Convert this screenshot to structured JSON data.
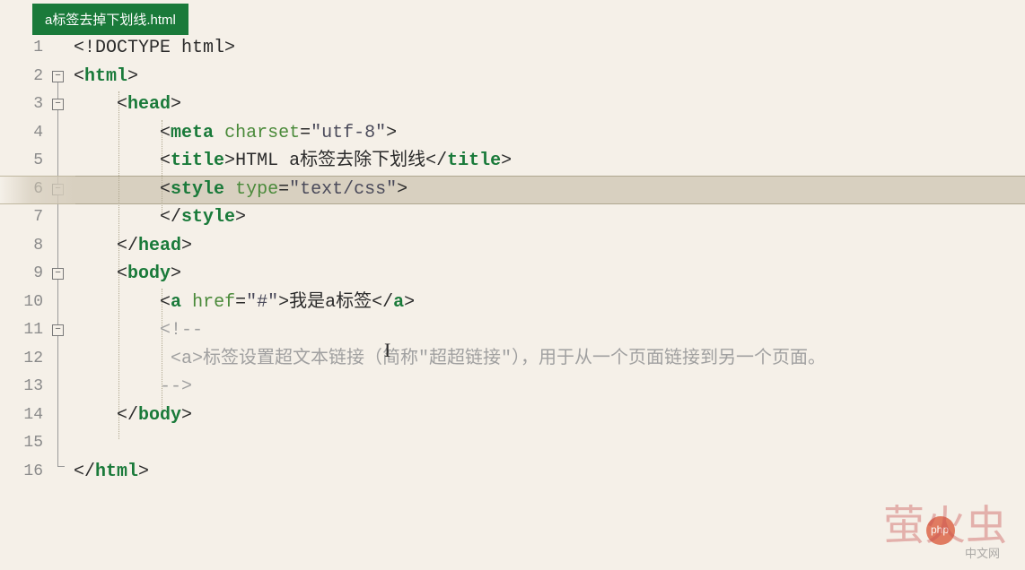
{
  "tab": {
    "filename": "a标签去掉下划线.html"
  },
  "lines": [
    "1",
    "2",
    "3",
    "4",
    "5",
    "6",
    "7",
    "8",
    "9",
    "10",
    "11",
    "12",
    "13",
    "14",
    "15",
    "16"
  ],
  "code": {
    "l1": {
      "doctype": "<!DOCTYPE html>"
    },
    "l2": {
      "open": "<",
      "tag": "html",
      "close": ">"
    },
    "l3": {
      "open": "<",
      "tag": "head",
      "close": ">"
    },
    "l4": {
      "open": "<",
      "tag": "meta",
      "sp": " ",
      "attr": "charset",
      "eq": "=",
      "val": "\"utf-8\"",
      "close": ">"
    },
    "l5": {
      "open": "<",
      "tag": "title",
      "close": ">",
      "text": "HTML a标签去除下划线",
      "open2": "</",
      "tag2": "title",
      "close2": ">"
    },
    "l6": {
      "open": "<",
      "tag": "style",
      "sp": " ",
      "attr": "type",
      "eq": "=",
      "val": "\"text/css\"",
      "close": ">"
    },
    "l7": {
      "open": "</",
      "tag": "style",
      "close": ">"
    },
    "l8": {
      "open": "</",
      "tag": "head",
      "close": ">"
    },
    "l9": {
      "open": "<",
      "tag": "body",
      "close": ">"
    },
    "l10": {
      "open": "<",
      "tag": "a",
      "sp": " ",
      "attr": "href",
      "eq": "=",
      "val": "\"#\"",
      "close": ">",
      "text": "我是a标签",
      "open2": "</",
      "tag2": "a",
      "close2": ">"
    },
    "l11": {
      "comment_open": "<!--"
    },
    "l12": {
      "comment_text_pre": "<a>",
      "comment_text": "标签设置超文本链接（简称\"超超链接\"），用于从一个页面链接到另一个页面。"
    },
    "l13": {
      "comment_close": "-->"
    },
    "l14": {
      "open": "</",
      "tag": "body",
      "close": ">"
    },
    "l16": {
      "open": "</",
      "tag": "html",
      "close": ">"
    }
  },
  "watermark": {
    "main": "萤火虫",
    "small": "中文网"
  }
}
